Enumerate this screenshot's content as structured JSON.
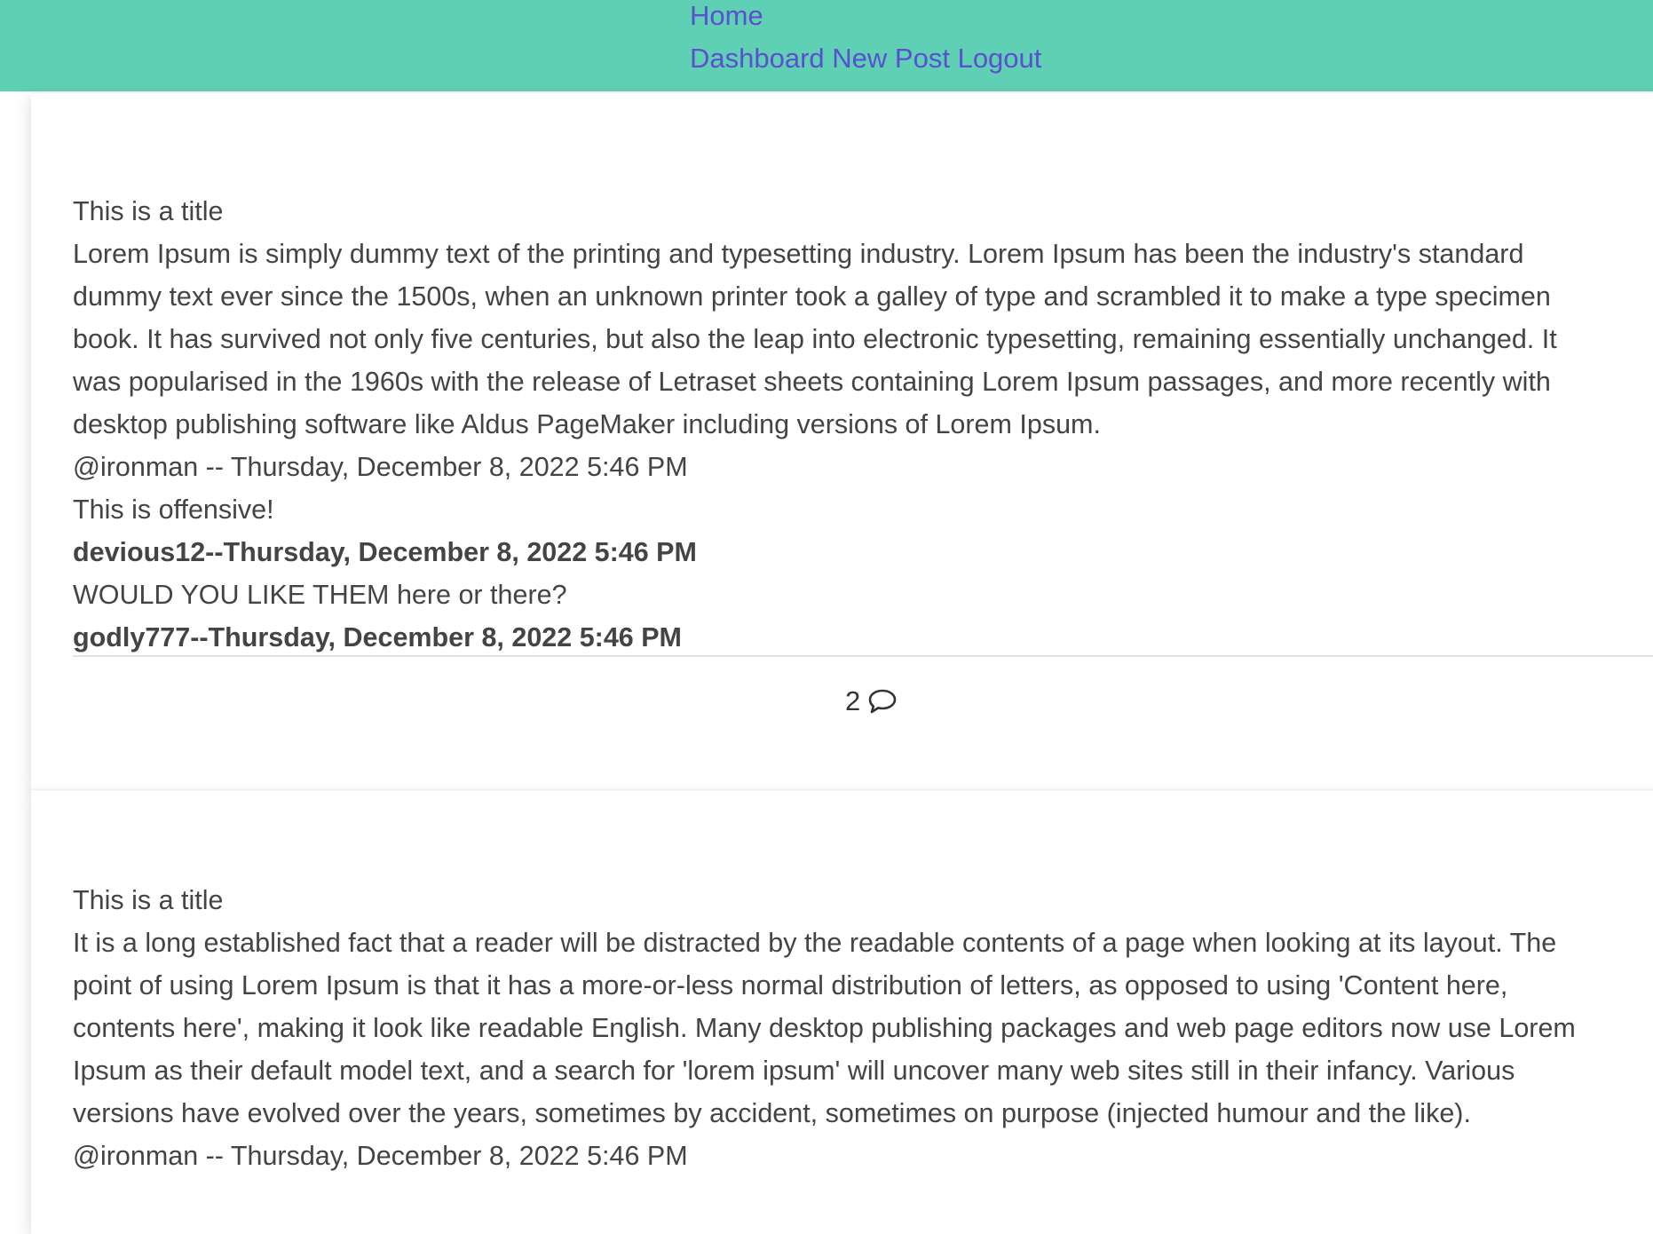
{
  "nav": {
    "home": "Home",
    "dashboard": "Dashboard",
    "new_post": "New Post",
    "logout": "Logout"
  },
  "posts": [
    {
      "title": "This is a title",
      "body_lines": [
        "Lorem Ipsum is simply dummy text of the printing and typesetting industry. Lorem Ipsum has been the industry's standard",
        "dummy text ever since the 1500s, when an unknown printer took a galley of type and scrambled it to make a type specimen",
        "book. It has survived not only five centuries, but also the leap into electronic typesetting, remaining essentially unchanged. It",
        "was popularised in the 1960s with the release of Letraset sheets containing Lorem Ipsum passages, and more recently with",
        "desktop publishing software like Aldus PageMaker including versions of Lorem Ipsum."
      ],
      "author_line": "@ironman -- Thursday, December 8, 2022 5:46 PM",
      "comments": [
        {
          "text": "This is offensive!",
          "meta": "devious12--Thursday, December 8, 2022 5:46 PM"
        },
        {
          "text": "WOULD YOU LIKE THEM here or there?",
          "meta": "godly777--Thursday, December 8, 2022 5:46 PM"
        }
      ],
      "comment_count": "2",
      "comment_icon": "speech-bubble-icon"
    },
    {
      "title": "This is a title",
      "body_lines": [
        "It is a long established fact that a reader will be distracted by the readable contents of a page when looking at its layout. The",
        "point of using Lorem Ipsum is that it has a more-or-less normal distribution of letters, as opposed to using 'Content here,",
        "contents here', making it look like readable English. Many desktop publishing packages and web page editors now use Lorem",
        "Ipsum as their default model text, and a search for 'lorem ipsum' will uncover many web sites still in their infancy. Various",
        "versions have evolved over the years, sometimes by accident, sometimes on purpose (injected humour and the like)."
      ],
      "author_line": "@ironman -- Thursday, December 8, 2022 5:46 PM"
    }
  ],
  "colors": {
    "navbar_bg": "#5fd0b4",
    "link": "#5a4fcf",
    "text": "#444444"
  }
}
